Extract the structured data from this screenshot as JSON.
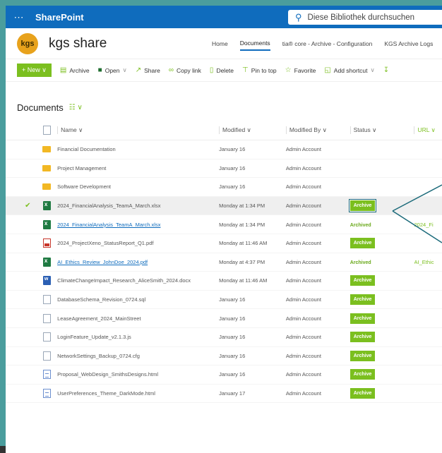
{
  "topbar": {
    "app": "SharePoint",
    "search_placeholder": "Diese Bibliothek durchsuchen"
  },
  "site": {
    "logo": "kgs",
    "title": "kgs share"
  },
  "nav": [
    "Home",
    "Documents",
    "tia® core - Archive - Configuration",
    "KGS Archive Logs"
  ],
  "commands": {
    "new": "+ New ∨",
    "archive": "Archive",
    "open": "Open",
    "share": "Share",
    "copy_link": "Copy link",
    "delete": "Delete",
    "pin": "Pin to top",
    "favorite": "Favorite",
    "add_shortcut": "Add shortcut"
  },
  "library": {
    "title": "Documents"
  },
  "columns": {
    "name": "Name",
    "modified": "Modified",
    "modified_by": "Modified By",
    "status": "Status",
    "url": "URL"
  },
  "rows": [
    {
      "icon": "folder",
      "name": "Financial Documentation",
      "modified": "January 16",
      "by": "Admin Account",
      "status": "",
      "url": ""
    },
    {
      "icon": "folder",
      "name": "Project Management",
      "modified": "January 16",
      "by": "Admin Account",
      "status": "",
      "url": ""
    },
    {
      "icon": "folder",
      "name": "Software Development",
      "modified": "January 16",
      "by": "Admin Account",
      "status": "",
      "url": ""
    },
    {
      "icon": "xlsx",
      "name": "2024_FinancialAnalysis_TeamA_March.xlsx",
      "modified": "Monday at 1:34 PM",
      "by": "Admin Account",
      "status": "Archive",
      "url": "",
      "selected": true
    },
    {
      "icon": "xlsx",
      "name": "2024_FinancialAnalysis_TeamA_March.xlsx",
      "modified": "Monday at 1:34 PM",
      "by": "Admin Account",
      "status": "Archived",
      "url": "2024_Fi",
      "link": true
    },
    {
      "icon": "pdf",
      "name": "2024_ProjectXeno_StatusReport_Q1.pdf",
      "modified": "Monday at 11:46 AM",
      "by": "Admin Account",
      "status": "Archive",
      "url": ""
    },
    {
      "icon": "xlsx",
      "name": "AI_Ethics_Review_JohnDoe_2024.pdf",
      "modified": "Monday at 4:37 PM",
      "by": "Admin Account",
      "status": "Archived",
      "url": "AI_Ethic",
      "link": true
    },
    {
      "icon": "docx",
      "name": "ClimateChangeImpact_Research_AliceSmith_2024.docx",
      "modified": "Monday at 11:46 AM",
      "by": "Admin Account",
      "status": "Archive",
      "url": ""
    },
    {
      "icon": "gen",
      "name": "DatabaseSchema_Revision_0724.sql",
      "modified": "January 16",
      "by": "Admin Account",
      "status": "Archive",
      "url": ""
    },
    {
      "icon": "gen",
      "name": "LeaseAgreement_2024_MainStreet",
      "modified": "January 16",
      "by": "Admin Account",
      "status": "Archive",
      "url": ""
    },
    {
      "icon": "gen",
      "name": "LoginFeature_Update_v2.1.3.js",
      "modified": "January 16",
      "by": "Admin Account",
      "status": "Archive",
      "url": ""
    },
    {
      "icon": "gen",
      "name": "NetworkSettings_Backup_0724.cfg",
      "modified": "January 16",
      "by": "Admin Account",
      "status": "Archive",
      "url": ""
    },
    {
      "icon": "code",
      "name": "Proposal_WebDesign_SmithsDesigns.html",
      "modified": "January 16",
      "by": "Admin Account",
      "status": "Archive",
      "url": ""
    },
    {
      "icon": "code",
      "name": "UserPreferences_Theme_DarkMode.html",
      "modified": "January 17",
      "by": "Admin Account",
      "status": "Archive",
      "url": ""
    }
  ],
  "colors": {
    "brand": "#0f6cbd",
    "accent": "#7bbf1f",
    "frame": "#4a9d9d",
    "callout": "#1b6a7a"
  }
}
